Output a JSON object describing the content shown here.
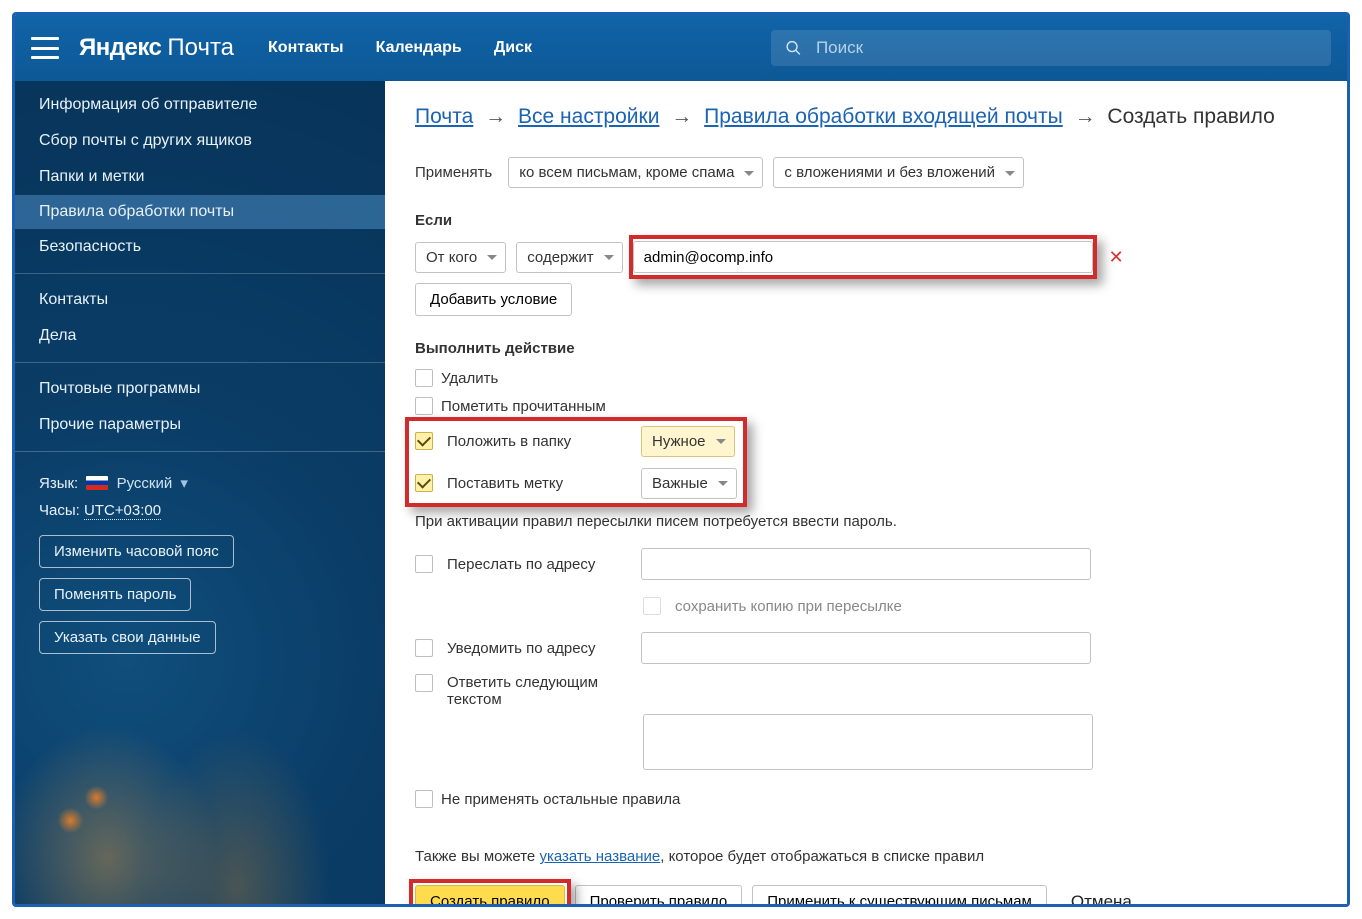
{
  "header": {
    "brand_y": "Яндекс",
    "brand_p": "Почта",
    "nav": [
      "Контакты",
      "Календарь",
      "Диск"
    ],
    "search_placeholder": "Поиск"
  },
  "sidebar": {
    "items": [
      "Информация об отправителе",
      "Сбор почты с других ящиков",
      "Папки и метки",
      "Правила обработки почты",
      "Безопасность"
    ],
    "active_index": 3,
    "items2": [
      "Контакты",
      "Дела"
    ],
    "items3": [
      "Почтовые программы",
      "Прочие параметры"
    ],
    "lang_label": "Язык:",
    "lang_value": "Русский",
    "clock_label": "Часы:",
    "clock_value": "UTC+03:00",
    "buttons": [
      "Изменить часовой пояс",
      "Поменять пароль",
      "Указать свои данные"
    ]
  },
  "breadcrumb": {
    "b1": "Почта",
    "b2": "Все настройки",
    "b3": "Правила обработки входящей почты",
    "current": "Создать правило"
  },
  "apply": {
    "label": "Применять",
    "sel1": "ко всем письмам, кроме спама",
    "sel2": "с вложениями и без вложений"
  },
  "cond": {
    "heading": "Если",
    "field": "От кого",
    "op": "содержит",
    "value": "admin@ocomp.info",
    "add": "Добавить условие"
  },
  "actions": {
    "heading": "Выполнить действие",
    "delete": "Удалить",
    "mark_read": "Пометить прочитанным",
    "put_folder": "Положить в папку",
    "folder_value": "Нужное",
    "set_label": "Поставить метку",
    "label_value": "Важные",
    "fwd_note": "При активации правил пересылки писем потребуется ввести пароль.",
    "forward": "Переслать по адресу",
    "keep_copy": "сохранить копию при пересылке",
    "notify": "Уведомить по адресу",
    "reply": "Ответить следующим текстом",
    "stop_rules": "Не применять остальные правила"
  },
  "footer": {
    "also_pre": "Также вы можете ",
    "also_link": "указать название",
    "also_post": ", которое будет отображаться в списке правил",
    "create": "Создать правило",
    "check": "Проверить правило",
    "apply_existing": "Применить к существующим письмам",
    "cancel": "Отмена"
  }
}
